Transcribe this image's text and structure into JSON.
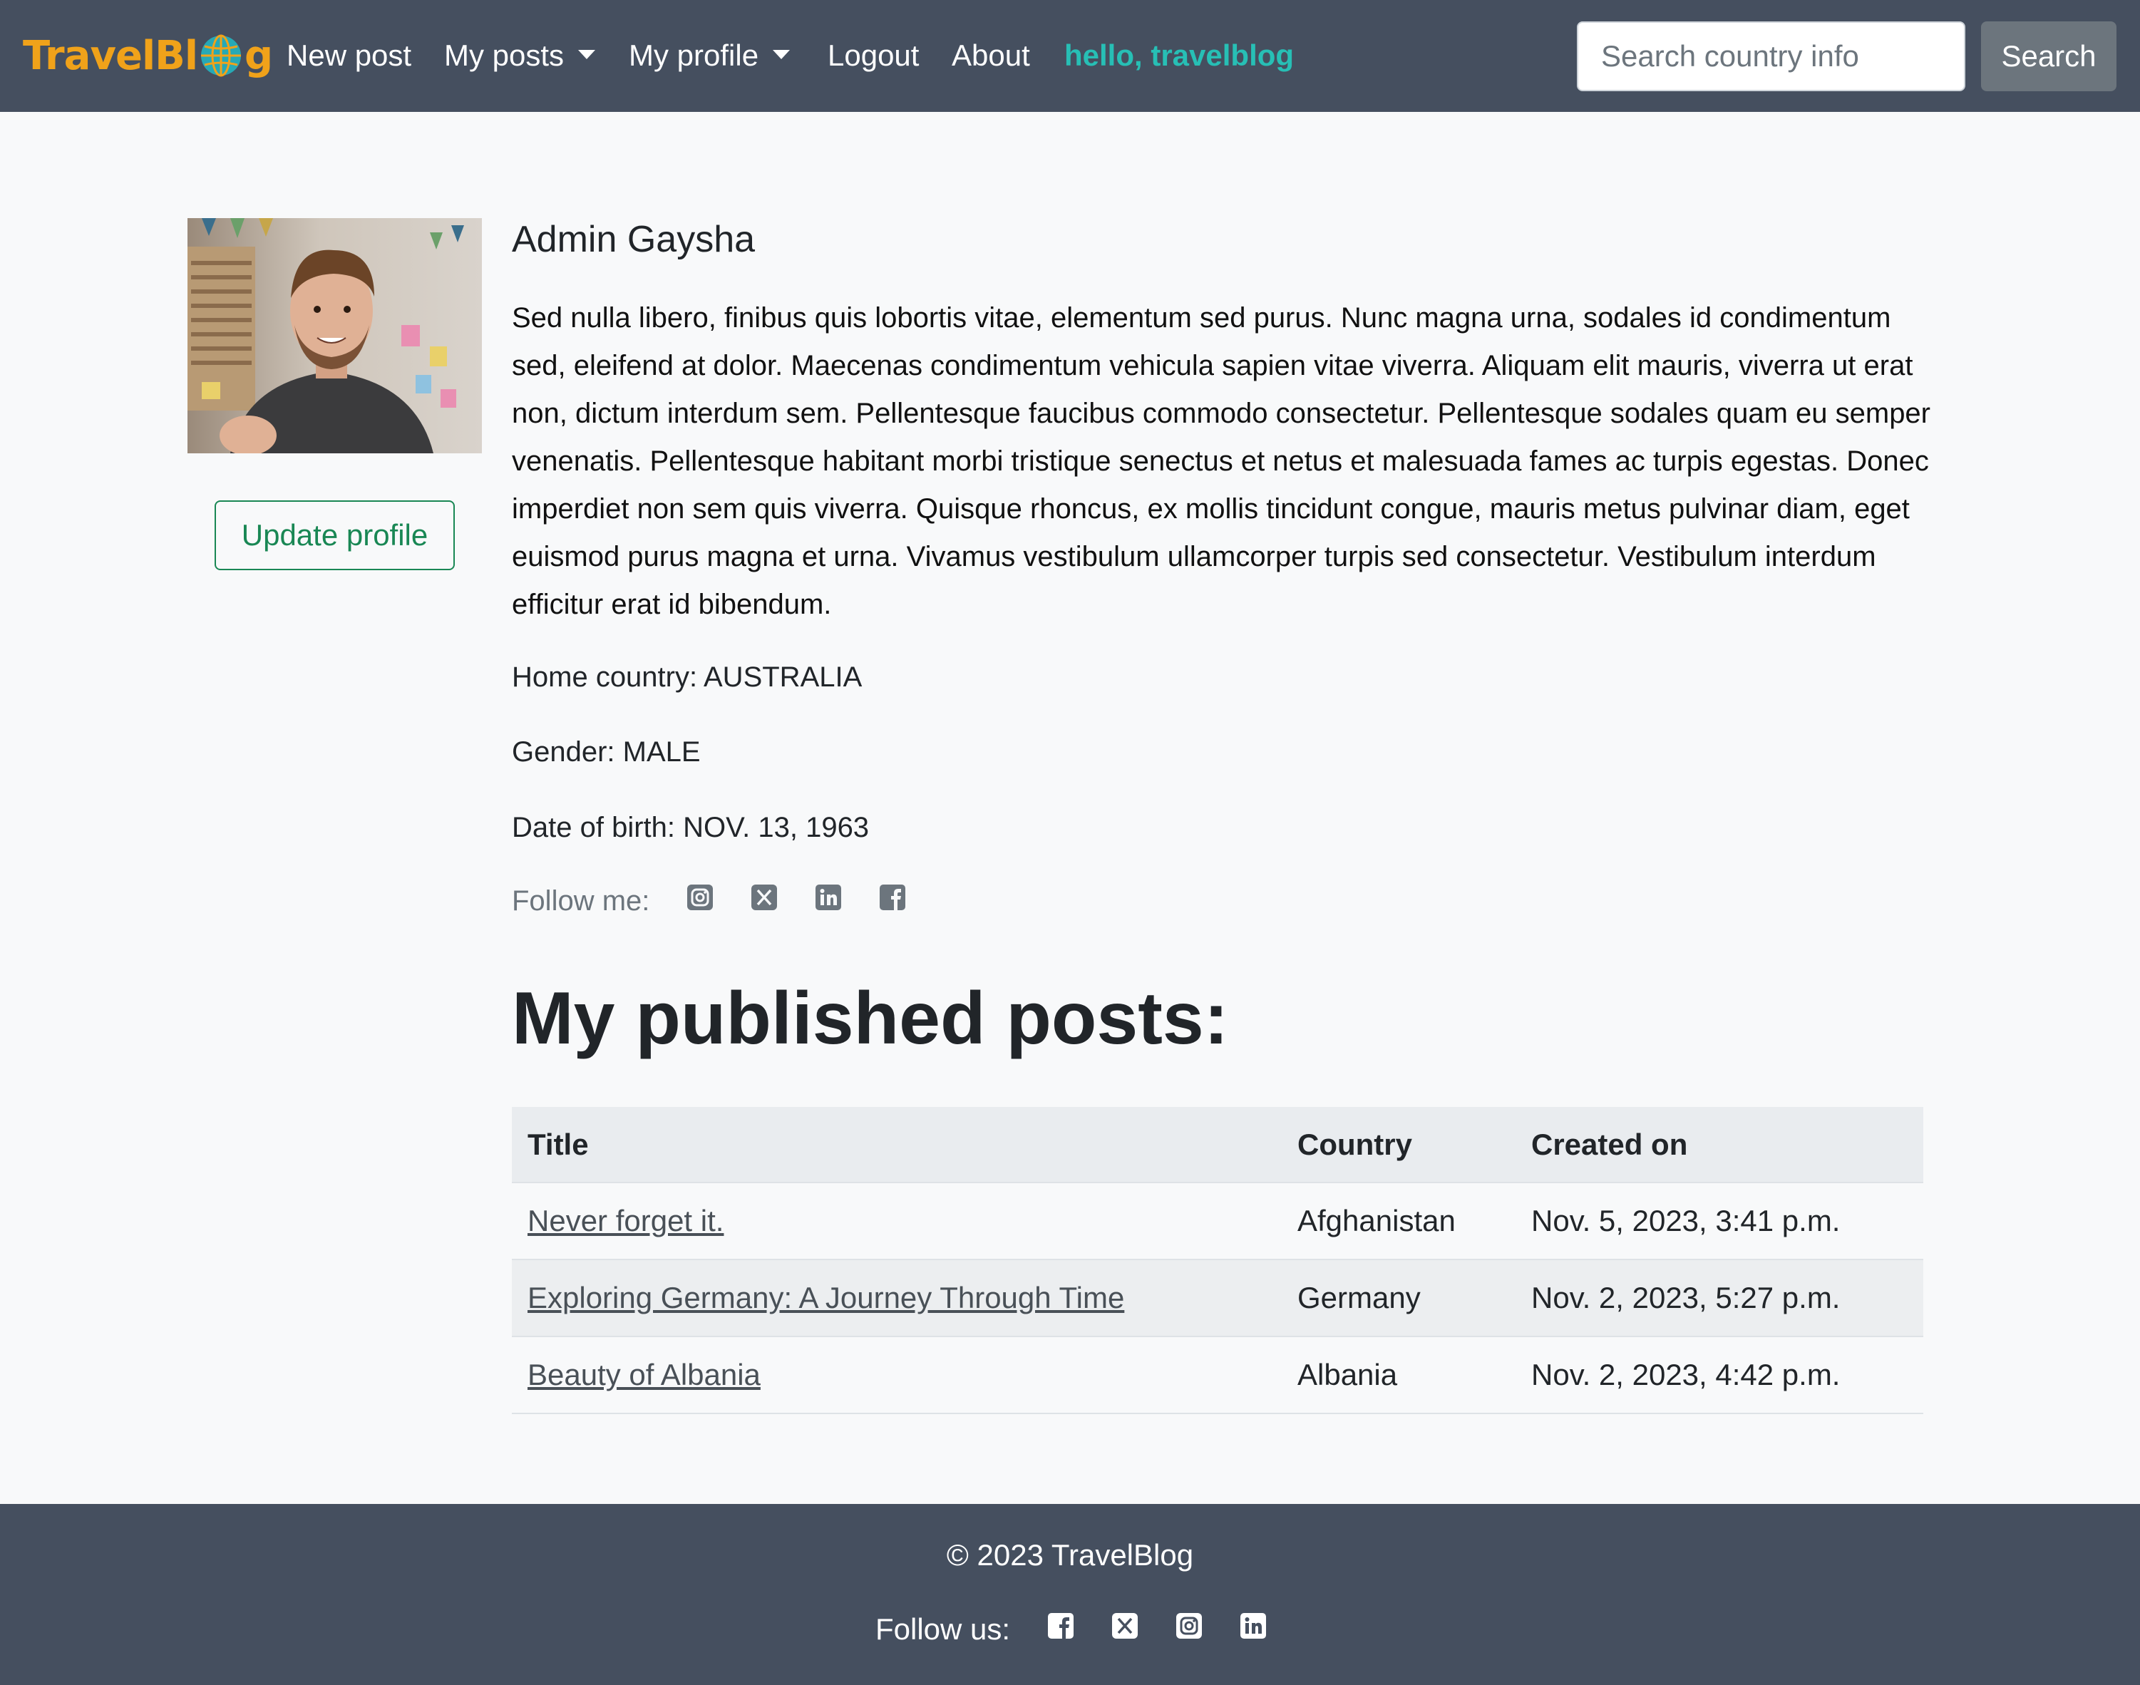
{
  "navbar": {
    "brand": "TravelBlog",
    "links": {
      "new_post": "New post",
      "my_posts": "My posts",
      "my_profile": "My profile",
      "logout": "Logout",
      "about": "About"
    },
    "greeting": "hello, travelblog",
    "search_placeholder": "Search country info",
    "search_button": "Search"
  },
  "profile": {
    "name": "Admin Gaysha",
    "bio": "Sed nulla libero, finibus quis lobortis vitae, elementum sed purus. Nunc magna urna, sodales id condimentum sed, eleifend at dolor. Maecenas condimentum vehicula sapien vitae viverra. Aliquam elit mauris, viverra ut erat non, dictum interdum sem. Pellentesque faucibus commodo consectetur. Pellentesque sodales quam eu semper venenatis. Pellentesque habitant morbi tristique senectus et netus et malesuada fames ac turpis egestas. Donec imperdiet non sem quis viverra. Quisque rhoncus, ex mollis tincidunt congue, mauris metus pulvinar diam, eget euismod purus magna et urna. Vivamus vestibulum ullamcorper turpis sed consectetur. Vestibulum interdum efficitur erat id bibendum.",
    "home_country": "Home country: AUSTRALIA",
    "gender": "Gender: MALE",
    "date_of_birth": "Date of birth: NOV. 13, 1963",
    "follow_label": "Follow me:",
    "follow_icons": [
      "instagram-icon",
      "x-twitter-icon",
      "linkedin-icon",
      "facebook-icon"
    ],
    "update_button": "Update profile"
  },
  "posts": {
    "heading": "My published posts:",
    "columns": [
      "Title",
      "Country",
      "Created on"
    ],
    "rows": [
      {
        "title": "Never forget it.",
        "country": "Afghanistan",
        "created": "Nov. 5, 2023, 3:41 p.m."
      },
      {
        "title": "Exploring Germany: A Journey Through Time",
        "country": "Germany",
        "created": "Nov. 2, 2023, 5:27 p.m."
      },
      {
        "title": "Beauty of Albania",
        "country": "Albania",
        "created": "Nov. 2, 2023, 4:42 p.m."
      }
    ]
  },
  "footer": {
    "copyright": "© 2023 TravelBlog",
    "follow_label": "Follow us:",
    "follow_icons": [
      "facebook-icon",
      "x-twitter-icon",
      "instagram-icon",
      "linkedin-icon"
    ]
  },
  "colors": {
    "navbar_bg": "#454f5f",
    "brand": "#f0a21a",
    "greeting": "#27bfb5",
    "update_button": "#198754",
    "search_button": "#6c757d"
  }
}
